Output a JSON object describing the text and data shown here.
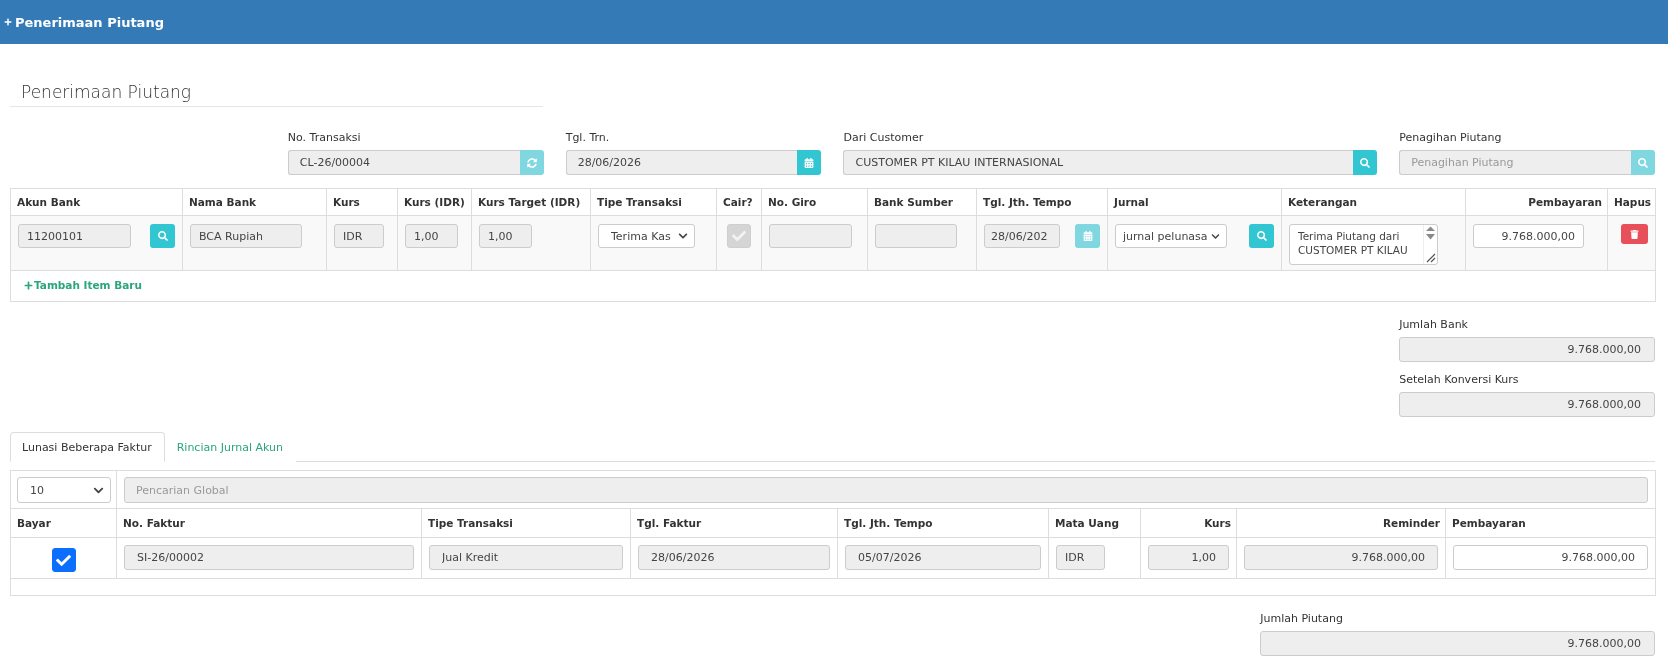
{
  "header": {
    "title": "Penerimaan Piutang"
  },
  "page_title": "Penerimaan Piutang",
  "form_fields": [
    {
      "label": "No. Transaksi",
      "value": "CL-26/00004",
      "kind": "refresh",
      "button_disabled": true
    },
    {
      "label": "Tgl. Trn.",
      "value": "28/06/2026",
      "kind": "calendar",
      "button_disabled": false
    },
    {
      "label": "Dari Customer",
      "value": "CUSTOMER PT KILAU INTERNASIONAL",
      "kind": "search",
      "button_disabled": false
    },
    {
      "label": "Penagihan Piutang",
      "placeholder": "Penagihan Piutang",
      "kind": "search",
      "button_disabled": true
    }
  ],
  "bank_table": {
    "columns": [
      "Akun Bank",
      "Nama Bank",
      "Kurs",
      "Kurs (IDR)",
      "Kurs Target (IDR)",
      "Tipe Transaksi",
      "Cair?",
      "No. Giro",
      "Bank Sumber",
      "Tgl. Jth. Tempo",
      "Jurnal",
      "Keterangan",
      "Pembayaran",
      "Hapus"
    ],
    "rows": [
      {
        "akun_bank": "11200101",
        "nama_bank": "BCA Rupiah",
        "kurs": "IDR",
        "kurs_idr": "1,00",
        "kurs_target": "1,00",
        "tipe_transaksi": "Terima Kas",
        "cair": {
          "checked": true,
          "disabled": true
        },
        "tgl_jth_tempo": "28/06/202",
        "calendar_disabled": true,
        "jurnal": "jurnal pelunasa",
        "keterangan": "Terima Piutang dari CUSTOMER PT KILAU",
        "pembayaran": "9.768.000,00"
      }
    ],
    "add_link": "Tambah Item Baru"
  },
  "totals": [
    {
      "label": "Jumlah Bank",
      "value": "9.768.000,00"
    },
    {
      "label": "Setelah Konversi Kurs",
      "value": "9.768.000,00"
    }
  ],
  "tabs": [
    {
      "label": "Lunasi Beberapa Faktur",
      "selected": true
    },
    {
      "label": "Rincian Jurnal Akun",
      "selected": false
    }
  ],
  "invoice_table": {
    "page_size": "10",
    "search": {
      "placeholder": "Pencarian Global"
    },
    "columns": [
      "Bayar",
      "No. Faktur",
      "Tipe Transaksi",
      "Tgl. Faktur",
      "Tgl. Jth. Tempo",
      "Mata Uang",
      "Kurs",
      "Reminder",
      "Pembayaran"
    ],
    "rows": [
      {
        "bayar": true,
        "no_faktur": "SI-26/00002",
        "tipe_transaksi": "Jual Kredit",
        "tgl_faktur": "28/06/2026",
        "tgl_jth_tempo": "05/07/2026",
        "mata_uang": "IDR",
        "kurs": "1,00",
        "reminder": "9.768.000,00",
        "pembayaran": "9.768.000,00"
      }
    ]
  },
  "jumlah_piutang": {
    "label": "Jumlah Piutang",
    "value": "9.768.000,00"
  }
}
